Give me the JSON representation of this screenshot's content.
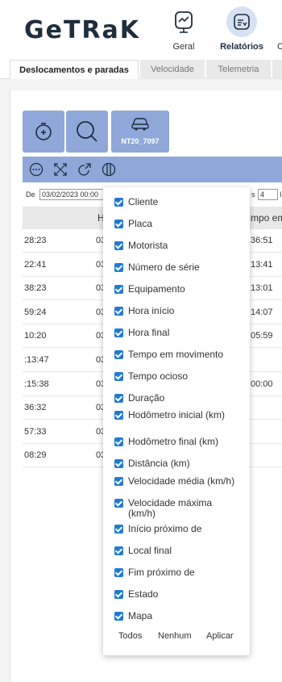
{
  "brand": {
    "logo": "GeTRaK"
  },
  "nav": [
    {
      "label": "Geral",
      "icon": "monitor-chart-icon",
      "active": false
    },
    {
      "label": "Relatórios",
      "icon": "report-list-icon",
      "active": true
    },
    {
      "label": "C",
      "icon": "",
      "active": false
    }
  ],
  "tabs": [
    {
      "label": "Deslocamentos e paradas",
      "active": true
    },
    {
      "label": "Velocidade",
      "active": false
    },
    {
      "label": "Telemetria",
      "active": false
    }
  ],
  "vehicle": {
    "label": "NT20_7097"
  },
  "filters": {
    "from_label": "De",
    "from_value": "03/02/2023 00:00",
    "right_label": "s",
    "right_value": "4",
    "right_tail": "I"
  },
  "table": {
    "header_h": "H",
    "header_right": "mpo em",
    "rows": [
      {
        "c1": "28:23",
        "c2": "03",
        "c3": "36:51"
      },
      {
        "c1": "22:41",
        "c2": "03",
        "c3": "13:41"
      },
      {
        "c1": "38:23",
        "c2": "03",
        "c3": "13:01"
      },
      {
        "c1": "59:24",
        "c2": "03",
        "c3": "14:07"
      },
      {
        "c1": "10:20",
        "c2": "03",
        "c3": "05:59"
      },
      {
        "c1": ":13:47",
        "c2": "03",
        "c3": ""
      },
      {
        "c1": ":15:38",
        "c2": "03",
        "c3": "00:00"
      },
      {
        "c1": "36:32",
        "c2": "03",
        "c3": ""
      },
      {
        "c1": "57:33",
        "c2": "03",
        "c3": ""
      },
      {
        "c1": "08:29",
        "c2": "03",
        "c3": ""
      }
    ]
  },
  "column_chooser": {
    "options": [
      "Cliente",
      "Placa",
      "Motorista",
      "Número de série",
      "Equipamento",
      "Hora início",
      "Hora final",
      "Tempo em movimento",
      "Tempo ocioso",
      "Duração",
      "Hodômetro inicial (km)",
      "Hodômetro final (km)",
      "Distância (km)",
      "Velocidade média (km/h)",
      "Velocidade máxima (km/h)",
      "Início próximo de",
      "Local final",
      "Fim próximo de",
      "Estado",
      "Mapa"
    ],
    "all_label": "Todos",
    "none_label": "Nenhum",
    "apply_label": "Aplicar"
  },
  "colors": {
    "accent": "#8fa8d9",
    "checkbox": "#1f7ad6",
    "nav_active_bg": "#d7e1f4"
  }
}
